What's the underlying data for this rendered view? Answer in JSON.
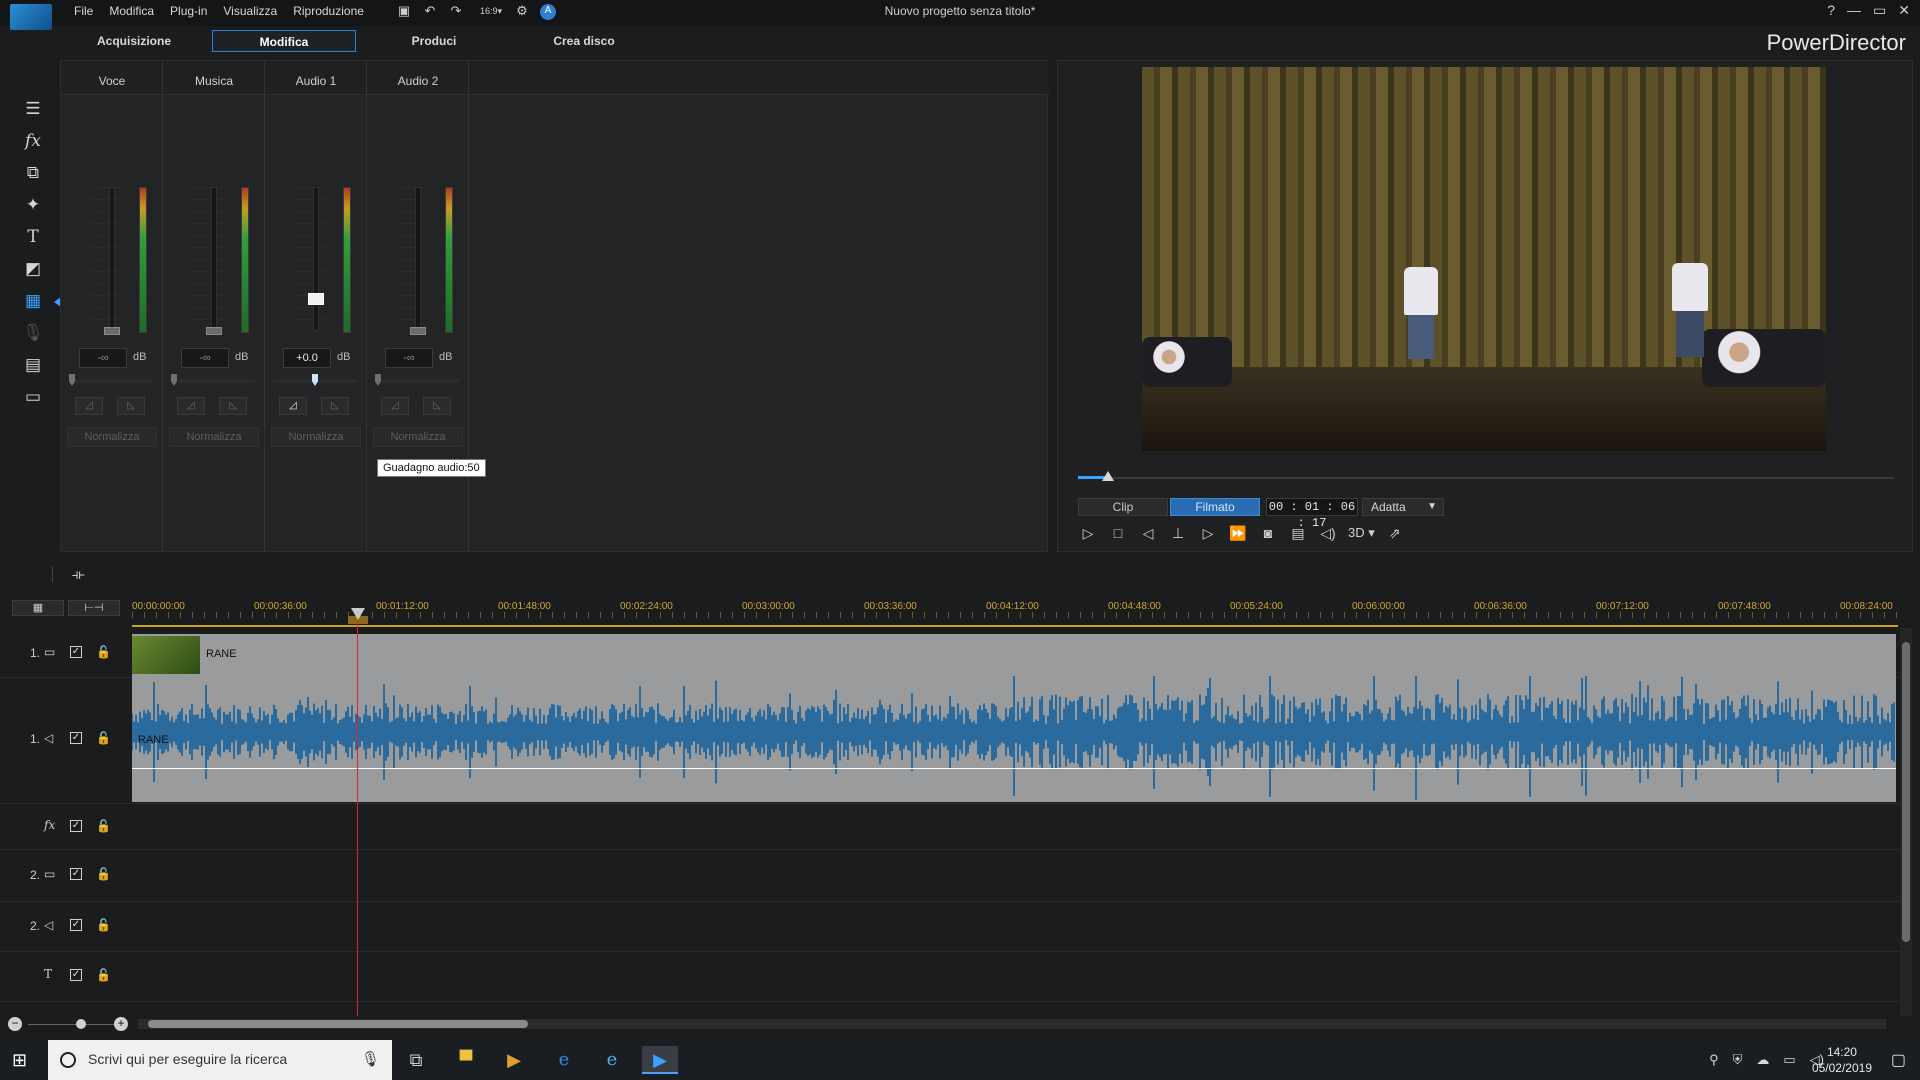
{
  "menu": [
    "File",
    "Modifica",
    "Plug-in",
    "Visualizza",
    "Riproduzione"
  ],
  "toolbar": {
    "aspect": "16:9"
  },
  "window": {
    "title": "Nuovo progetto senza titolo*",
    "help": "?",
    "minimize": "—",
    "restore": "▭",
    "close": "✕"
  },
  "tabs": [
    {
      "label": "Acquisizione"
    },
    {
      "label": "Modifica"
    },
    {
      "label": "Produci"
    },
    {
      "label": "Crea disco"
    }
  ],
  "brand": "PowerDirector",
  "mixer": {
    "channels": [
      {
        "name": "Voce",
        "db": "-∞",
        "unit": "dB",
        "normalize": "Normalizza"
      },
      {
        "name": "Musica",
        "db": "-∞",
        "unit": "dB",
        "normalize": "Normalizza"
      },
      {
        "name": "Audio 1",
        "db": "+0.0",
        "unit": "dB",
        "normalize": "Normalizza"
      },
      {
        "name": "Audio 2",
        "db": "-∞",
        "unit": "dB",
        "normalize": "Normalizza"
      }
    ],
    "tooltip": "Guadagno audio:50"
  },
  "preview": {
    "mode_clip": "Clip",
    "mode_movie": "Filmato",
    "timecode": "00 : 01 : 06 : 17",
    "fit": "Adatta",
    "threed": "3D",
    "playback_position": 0.03
  },
  "timeline": {
    "ruler": [
      "00:00:00:00",
      "00:00:36:00",
      "00:01:12:00",
      "00:01:48:00",
      "00:02:24:00",
      "00:03:00:00",
      "00:03:36:00",
      "00:04:12:00",
      "00:04:48:00",
      "00:05:24:00",
      "00:06:00:00",
      "00:06:36:00",
      "00:07:12:00",
      "00:07:48:00",
      "00:08:24:00"
    ],
    "tracks": [
      {
        "num": "1.",
        "type": "video"
      },
      {
        "num": "1.",
        "type": "audio"
      },
      {
        "num": "",
        "type": "fx"
      },
      {
        "num": "2.",
        "type": "video"
      },
      {
        "num": "2.",
        "type": "audio"
      },
      {
        "num": "",
        "type": "title"
      }
    ],
    "video_clip": "RANE",
    "audio_clip": "RANE",
    "zoom_minus": "−",
    "zoom_plus": "+"
  },
  "taskbar": {
    "search_placeholder": "Scrivi qui per eseguire la ricerca",
    "time": "14:20",
    "date": "05/02/2019"
  }
}
